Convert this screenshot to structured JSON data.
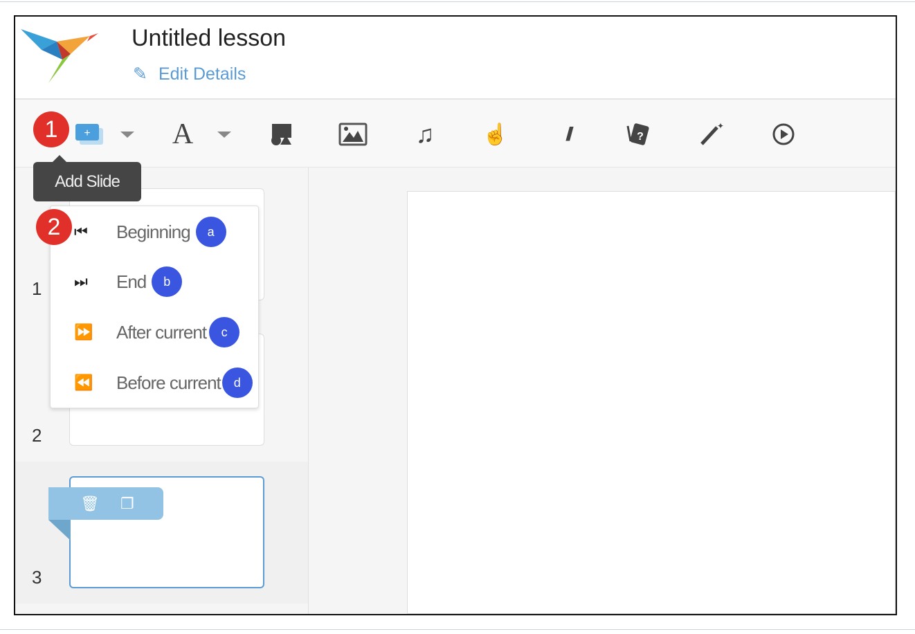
{
  "header": {
    "title": "Untitled lesson",
    "edit_label": "Edit Details"
  },
  "toolbar": {
    "items": [
      "add-slide",
      "text",
      "shapes",
      "image",
      "audio",
      "interaction",
      "drawing",
      "flashcards",
      "effects",
      "play"
    ]
  },
  "tooltip": "Add Slide",
  "annotations": {
    "step1": "1",
    "step2": "2"
  },
  "menu": {
    "items": [
      {
        "label": "Beginning",
        "badge": "a"
      },
      {
        "label": "End",
        "badge": "b"
      },
      {
        "label": "After current",
        "badge": "c"
      },
      {
        "label": "Before current",
        "badge": "d"
      }
    ]
  },
  "slides": {
    "numbers": [
      "1",
      "2",
      "3"
    ]
  },
  "colors": {
    "accent": "#5b9bd5",
    "badge": "#3a55e0",
    "marker": "#e1302a"
  }
}
